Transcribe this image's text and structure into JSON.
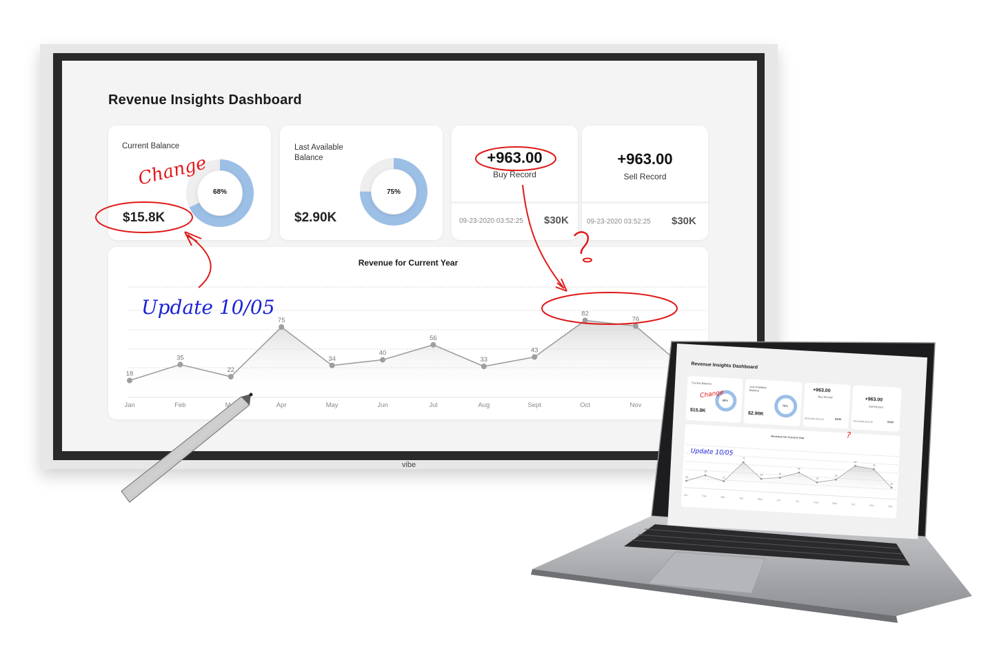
{
  "board": {
    "brand": "vibe",
    "dashboard_title": "Revenue Insights Dashboard",
    "current_balance": {
      "label": "Current Balance",
      "value": "$15.8K",
      "percent_label": "68%",
      "percent": 68
    },
    "last_balance": {
      "label_line1": "Last Available",
      "label_line2": "Balance",
      "value": "$2.90K",
      "percent_label": "75%",
      "percent": 75
    },
    "buy": {
      "value": "+963.00",
      "label": "Buy Record",
      "timestamp": "09-23-2020  03:52:25",
      "amount": "$30K"
    },
    "sell": {
      "value": "+963.00",
      "label": "Sell Record",
      "timestamp": "09-23-2020  03:52:25",
      "amount": "$30K"
    },
    "accent_color": "#9cbfe6",
    "annotation_color_red": "#e01818",
    "annotation_color_blue": "#1b22d6"
  },
  "annotations": {
    "change": "Change",
    "update": "Update 10/05",
    "question": "?"
  },
  "chart_data": {
    "type": "area",
    "title": "Revenue for Current Year",
    "categories": [
      "Jan",
      "Feb",
      "Mar",
      "Apr",
      "May",
      "Jun",
      "Jul",
      "Aug",
      "Sept",
      "Oct",
      "Nov",
      "Dec"
    ],
    "series": [
      {
        "values": [
          18,
          35,
          22,
          75,
          34,
          40,
          56,
          33,
          43,
          82,
          76,
          30
        ]
      }
    ],
    "grid": true
  },
  "laptop": {
    "dashboard_title": "Revenue Insights Dashboard",
    "current_balance_label": "Current Balance",
    "current_balance_value": "$15.8K",
    "current_balance_pct": "68%",
    "last_balance_label_line1": "Last Available",
    "last_balance_label_line2": "Balance",
    "last_balance_value": "$2.90K",
    "last_balance_pct": "75%",
    "buy_value": "+963.00",
    "buy_label": "Buy Record",
    "sell_value": "+963.00",
    "sell_label": "Sell Record",
    "timestamp": "09-23-2020  03:52:25",
    "amount": "$30K",
    "chart_title": "Revenue for Current Year",
    "annotation_change": "Change",
    "annotation_update": "Update 10/05",
    "annotation_question": "?"
  }
}
